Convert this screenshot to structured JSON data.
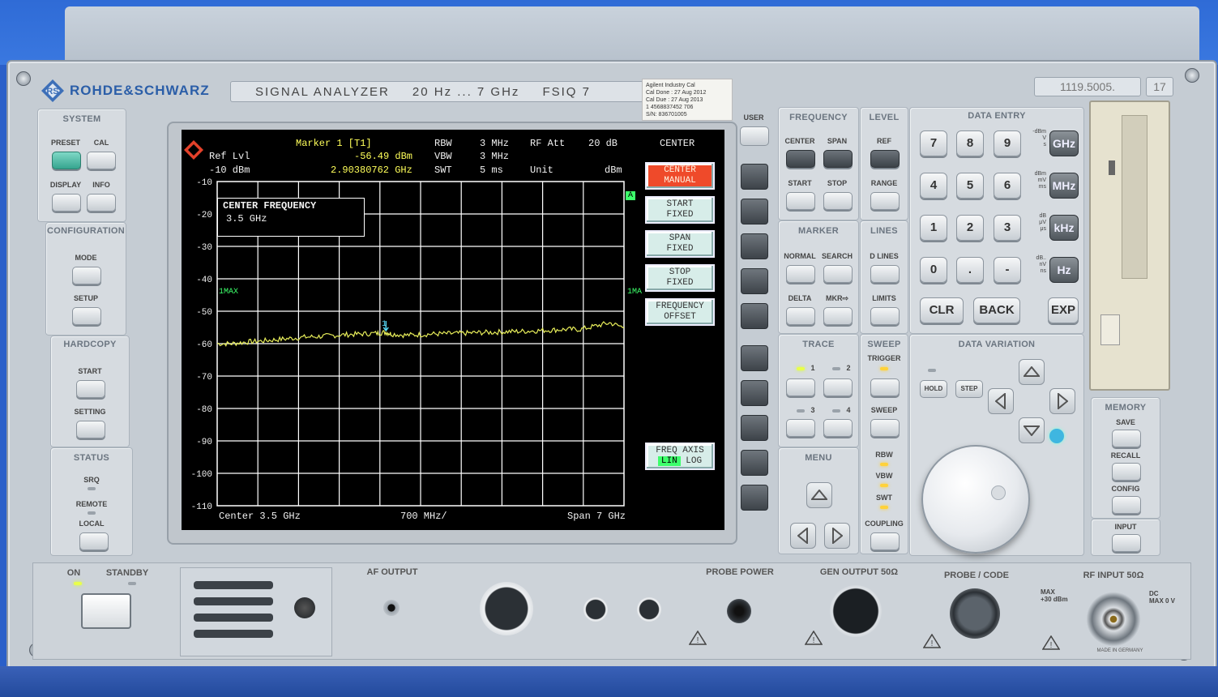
{
  "header": {
    "brand": "ROHDE&SCHWARZ",
    "model_title": "SIGNAL ANALYZER",
    "range": "20 Hz ... 7 GHz",
    "model": "FSIQ 7",
    "serial": "1119.5005.",
    "variant": "17",
    "cal_sticker": [
      "Agilent Industry Cal",
      "Cal Done : 27 Aug 2012",
      "Cal Due : 27 Aug 2013",
      "1 4568837452 706",
      "S/N: 836701005"
    ]
  },
  "screen": {
    "marker_title": "Marker 1 [T1]",
    "marker_level": "-56.49 dBm",
    "marker_freq": "2.90380762 GHz",
    "ref_lvl_label": "Ref Lvl",
    "ref_lvl_value": "-10 dBm",
    "rbw_label": "RBW",
    "rbw_value": "3 MHz",
    "vbw_label": "VBW",
    "vbw_value": "3 MHz",
    "swt_label": "SWT",
    "swt_value": "5 ms",
    "rfatt_label": "RF Att",
    "rfatt_value": "20 dB",
    "unit_label": "Unit",
    "unit_value": "dBm",
    "input_box_title": "CENTER FREQUENCY",
    "input_box_value": "3.5 GHz",
    "trace_tag_left": "1MAX",
    "trace_tag_right": "1MA",
    "tag_a": "A",
    "marker_number": "1",
    "footer_center": "Center 3.5 GHz",
    "footer_div": "700 MHz/",
    "footer_span": "Span 7 GHz",
    "y_ticks": [
      "-10",
      "-20",
      "-30",
      "-40",
      "-50",
      "-60",
      "-70",
      "-80",
      "-90",
      "-100",
      "-110"
    ],
    "menu_title": "CENTER",
    "softkeys": [
      {
        "line1": "CENTER",
        "line2": "MANUAL"
      },
      {
        "line1": "START",
        "line2": "FIXED"
      },
      {
        "line1": "SPAN",
        "line2": "FIXED"
      },
      {
        "line1": "STOP",
        "line2": "FIXED"
      },
      {
        "line1": "FREQUENCY",
        "line2": "OFFSET"
      }
    ],
    "freq_axis_label": "FREQ AXIS",
    "freq_axis_lin": "LIN",
    "freq_axis_log": "LOG"
  },
  "chart_data": {
    "type": "line",
    "xlabel": "",
    "ylabel": "",
    "xlim": [
      0,
      7
    ],
    "ylim": [
      -110,
      -10
    ],
    "grid": true,
    "series": [
      {
        "x": [
          0,
          0.25,
          0.5,
          0.75,
          1,
          1.25,
          1.5,
          1.75,
          2,
          2.25,
          2.5,
          2.75,
          2.9,
          3,
          3.25,
          3.5,
          3.75,
          4,
          4.25,
          4.5,
          4.75,
          5,
          5.25,
          5.5,
          5.75,
          6,
          6.25,
          6.5,
          6.75,
          7
        ],
        "y": [
          -60,
          -60,
          -59.5,
          -59.2,
          -58.8,
          -58.4,
          -58,
          -57.8,
          -57.5,
          -57.2,
          -57,
          -56.8,
          -56.5,
          -57,
          -57.4,
          -57.2,
          -57,
          -56.9,
          -56.8,
          -56.6,
          -56.5,
          -56.3,
          -56.2,
          -56,
          -55.8,
          -55.6,
          -55.6,
          -54.6,
          -53.6,
          -55
        ]
      }
    ]
  },
  "panels": {
    "system": {
      "title": "SYSTEM",
      "preset": "PRESET",
      "cal": "CAL",
      "display": "DISPLAY",
      "info": "INFO"
    },
    "configuration": {
      "title": "CONFIGURATION",
      "mode": "MODE",
      "setup": "SETUP"
    },
    "hardcopy": {
      "title": "HARDCOPY",
      "start": "START",
      "setting": "SETTING"
    },
    "status": {
      "title": "STATUS",
      "srq": "SRQ",
      "remote": "REMOTE",
      "local": "LOCAL"
    },
    "user": "USER",
    "frequency": {
      "title": "FREQUENCY",
      "center": "CENTER",
      "span": "SPAN",
      "start": "START",
      "stop": "STOP"
    },
    "level": {
      "title": "LEVEL",
      "ref": "REF",
      "range": "RANGE"
    },
    "marker": {
      "title": "MARKER",
      "normal": "NORMAL",
      "search": "SEARCH",
      "delta": "DELTA",
      "mkr": "MKR⇨"
    },
    "lines": {
      "title": "LINES",
      "dlines": "D LINES",
      "limits": "LIMITS"
    },
    "trace": {
      "title": "TRACE",
      "t1": "1",
      "t2": "2",
      "t3": "3",
      "t4": "4"
    },
    "sweep": {
      "title": "SWEEP",
      "trigger": "TRIGGER",
      "sweep": "SWEEP",
      "rbw": "RBW",
      "vbw": "VBW",
      "swt": "SWT",
      "coupling": "COUPLING"
    },
    "menu": {
      "title": "MENU"
    },
    "data_entry": {
      "title": "DATA ENTRY",
      "keys": [
        "7",
        "8",
        "9",
        "4",
        "5",
        "6",
        "1",
        "2",
        "3",
        "0",
        ".",
        "-"
      ],
      "units": [
        "GHz",
        "MHz",
        "kHz",
        "Hz"
      ],
      "unit_hints": [
        "-dBm\nV\ns",
        "dBm\nmV\nms",
        "dB\nμV\nμs",
        "dB..\nnV\nns"
      ],
      "clr": "CLR",
      "back": "BACK",
      "exp": "EXP"
    },
    "data_variation": {
      "title": "DATA VARIATION",
      "hold": "HOLD",
      "step": "STEP"
    },
    "memory": {
      "title": "MEMORY",
      "save": "SAVE",
      "recall": "RECALL",
      "config": "CONFIG",
      "input": "INPUT"
    }
  },
  "bottom": {
    "on": "ON",
    "standby": "STANDBY",
    "af_output": "AF OUTPUT",
    "probe_power": "PROBE POWER",
    "gen_output": "GEN OUTPUT 50Ω",
    "probe_code": "PROBE / CODE",
    "rf_input": "RF INPUT 50Ω",
    "rf_max": "MAX\n+30 dBm",
    "rf_dc": "DC\nMAX 0 V",
    "made_in": "MADE IN GERMANY"
  },
  "colors": {
    "trace": "#e8ee5a",
    "softkey_active": "#ef4a2a",
    "grid": "#ffffff",
    "brand": "#2b5ea8"
  }
}
